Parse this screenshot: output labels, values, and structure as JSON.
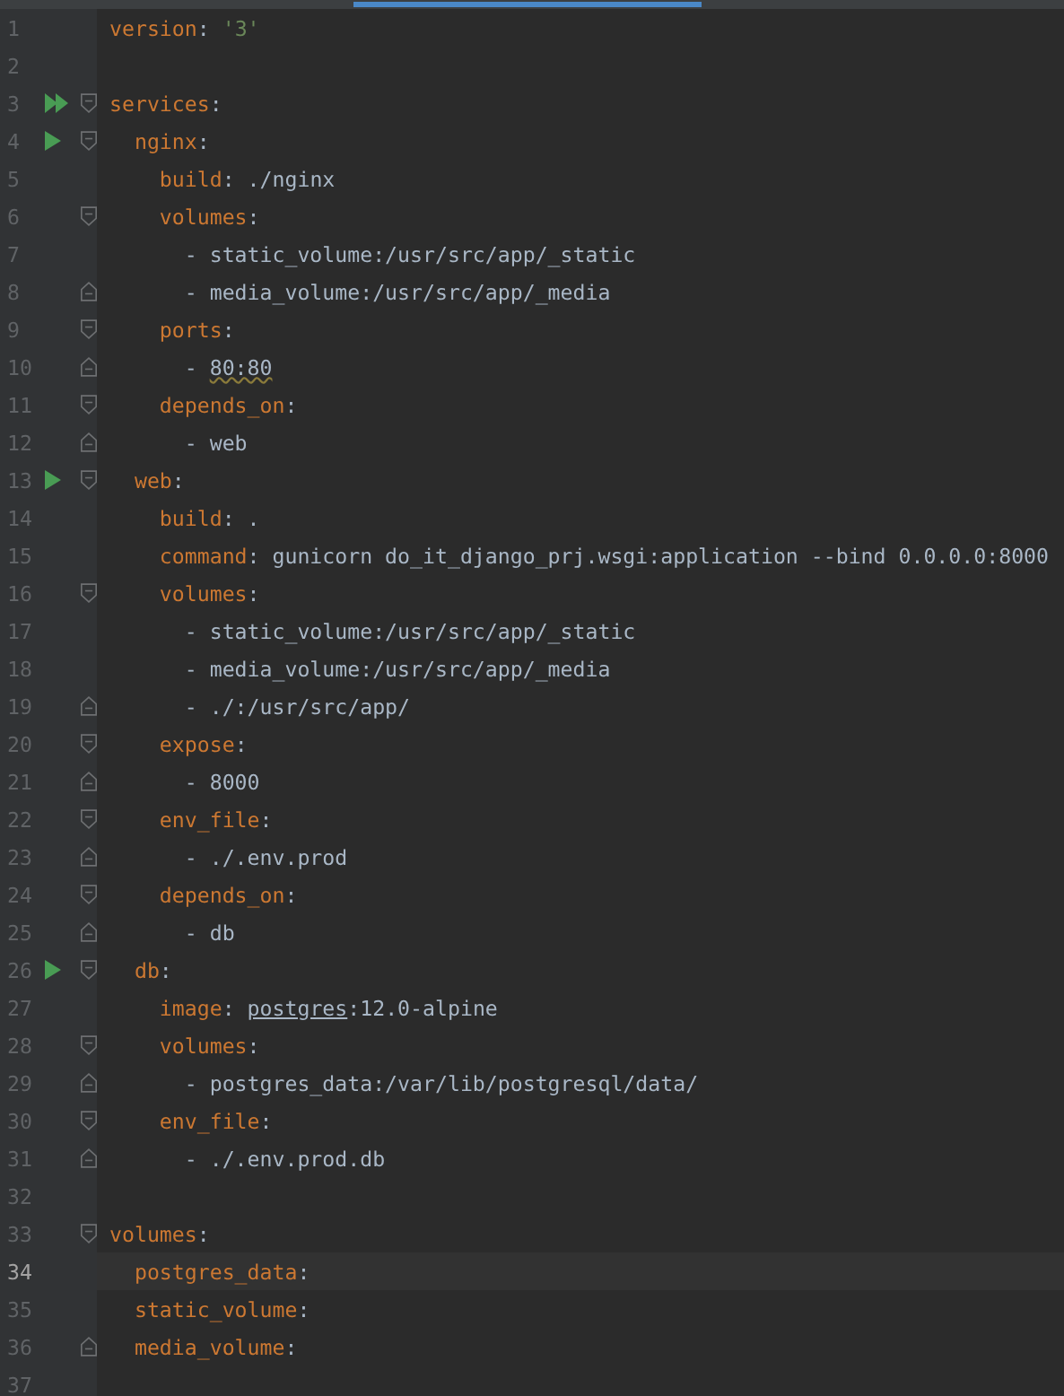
{
  "editor": {
    "lines": [
      {
        "number": "1",
        "tokens": [
          {
            "kind": "key",
            "text": "version"
          },
          {
            "kind": "plain",
            "text": ": "
          },
          {
            "kind": "string",
            "text": "'3'"
          }
        ]
      },
      {
        "number": "2"
      },
      {
        "number": "3",
        "run_all": true,
        "fold_start": true,
        "tokens": [
          {
            "kind": "key",
            "text": "services"
          },
          {
            "kind": "plain",
            "text": ":"
          }
        ]
      },
      {
        "number": "4",
        "run": true,
        "fold_start": true,
        "tokens": [
          {
            "kind": "key",
            "text": "  nginx"
          },
          {
            "kind": "plain",
            "text": ":"
          }
        ]
      },
      {
        "number": "5",
        "tokens": [
          {
            "kind": "key",
            "text": "    build"
          },
          {
            "kind": "plain",
            "text": ": ./nginx"
          }
        ]
      },
      {
        "number": "6",
        "fold_start": true,
        "tokens": [
          {
            "kind": "key",
            "text": "    volumes"
          },
          {
            "kind": "plain",
            "text": ":"
          }
        ]
      },
      {
        "number": "7",
        "tokens": [
          {
            "kind": "plain",
            "text": "      - static_volume:/usr/src/app/_static"
          }
        ]
      },
      {
        "number": "8",
        "fold_end": true,
        "tokens": [
          {
            "kind": "plain",
            "text": "      - media_volume:/usr/src/app/_media"
          }
        ]
      },
      {
        "number": "9",
        "fold_start": true,
        "tokens": [
          {
            "kind": "key",
            "text": "    ports"
          },
          {
            "kind": "plain",
            "text": ":"
          }
        ]
      },
      {
        "number": "10",
        "fold_end": true,
        "tokens": [
          {
            "kind": "plain",
            "text": "      - "
          },
          {
            "kind": "warning",
            "text": "80:80"
          }
        ]
      },
      {
        "number": "11",
        "fold_start": true,
        "tokens": [
          {
            "kind": "key",
            "text": "    depends_on"
          },
          {
            "kind": "plain",
            "text": ":"
          }
        ]
      },
      {
        "number": "12",
        "fold_end": true,
        "tokens": [
          {
            "kind": "plain",
            "text": "      - web"
          }
        ]
      },
      {
        "number": "13",
        "run": true,
        "fold_start": true,
        "tokens": [
          {
            "kind": "key",
            "text": "  web"
          },
          {
            "kind": "plain",
            "text": ":"
          }
        ]
      },
      {
        "number": "14",
        "tokens": [
          {
            "kind": "key",
            "text": "    build"
          },
          {
            "kind": "plain",
            "text": ": ."
          }
        ]
      },
      {
        "number": "15",
        "tokens": [
          {
            "kind": "key",
            "text": "    command"
          },
          {
            "kind": "plain",
            "text": ": gunicorn do_it_django_prj.wsgi:application --bind 0.0.0.0:8000"
          }
        ]
      },
      {
        "number": "16",
        "fold_start": true,
        "tokens": [
          {
            "kind": "key",
            "text": "    volumes"
          },
          {
            "kind": "plain",
            "text": ":"
          }
        ]
      },
      {
        "number": "17",
        "tokens": [
          {
            "kind": "plain",
            "text": "      - static_volume:/usr/src/app/_static"
          }
        ]
      },
      {
        "number": "18",
        "tokens": [
          {
            "kind": "plain",
            "text": "      - media_volume:/usr/src/app/_media"
          }
        ]
      },
      {
        "number": "19",
        "fold_end": true,
        "tokens": [
          {
            "kind": "plain",
            "text": "      - ./:/usr/src/app/"
          }
        ]
      },
      {
        "number": "20",
        "fold_start": true,
        "tokens": [
          {
            "kind": "key",
            "text": "    expose"
          },
          {
            "kind": "plain",
            "text": ":"
          }
        ]
      },
      {
        "number": "21",
        "fold_end": true,
        "tokens": [
          {
            "kind": "plain",
            "text": "      - 8000"
          }
        ]
      },
      {
        "number": "22",
        "fold_start": true,
        "tokens": [
          {
            "kind": "key",
            "text": "    env_file"
          },
          {
            "kind": "plain",
            "text": ":"
          }
        ]
      },
      {
        "number": "23",
        "fold_end": true,
        "tokens": [
          {
            "kind": "plain",
            "text": "      - ./.env.prod"
          }
        ]
      },
      {
        "number": "24",
        "fold_start": true,
        "tokens": [
          {
            "kind": "key",
            "text": "    depends_on"
          },
          {
            "kind": "plain",
            "text": ":"
          }
        ]
      },
      {
        "number": "25",
        "fold_end": true,
        "tokens": [
          {
            "kind": "plain",
            "text": "      - db"
          }
        ]
      },
      {
        "number": "26",
        "run": true,
        "fold_start": true,
        "tokens": [
          {
            "kind": "key",
            "text": "  db"
          },
          {
            "kind": "plain",
            "text": ":"
          }
        ]
      },
      {
        "number": "27",
        "tokens": [
          {
            "kind": "key",
            "text": "    image"
          },
          {
            "kind": "plain",
            "text": ": "
          },
          {
            "kind": "link",
            "text": "postgres"
          },
          {
            "kind": "plain",
            "text": ":12.0-alpine"
          }
        ]
      },
      {
        "number": "28",
        "fold_start": true,
        "tokens": [
          {
            "kind": "key",
            "text": "    volumes"
          },
          {
            "kind": "plain",
            "text": ":"
          }
        ]
      },
      {
        "number": "29",
        "fold_end": true,
        "tokens": [
          {
            "kind": "plain",
            "text": "      - postgres_data:/var/lib/postgresql/data/"
          }
        ]
      },
      {
        "number": "30",
        "fold_start": true,
        "tokens": [
          {
            "kind": "key",
            "text": "    env_file"
          },
          {
            "kind": "plain",
            "text": ":"
          }
        ]
      },
      {
        "number": "31",
        "fold_end": true,
        "tokens": [
          {
            "kind": "plain",
            "text": "      - ./.env.prod.db"
          }
        ]
      },
      {
        "number": "32"
      },
      {
        "number": "33",
        "fold_start": true,
        "tokens": [
          {
            "kind": "key",
            "text": "volumes"
          },
          {
            "kind": "plain",
            "text": ":"
          }
        ]
      },
      {
        "number": "34",
        "current": true,
        "tokens": [
          {
            "kind": "key",
            "text": "  postgres_data"
          },
          {
            "kind": "plain",
            "text": ":"
          }
        ]
      },
      {
        "number": "35",
        "tokens": [
          {
            "kind": "key",
            "text": "  static_volume"
          },
          {
            "kind": "plain",
            "text": ":"
          }
        ]
      },
      {
        "number": "36",
        "fold_end": true,
        "tokens": [
          {
            "kind": "key",
            "text": "  media_volume"
          },
          {
            "kind": "plain",
            "text": ":"
          }
        ]
      },
      {
        "number": "37"
      }
    ]
  }
}
